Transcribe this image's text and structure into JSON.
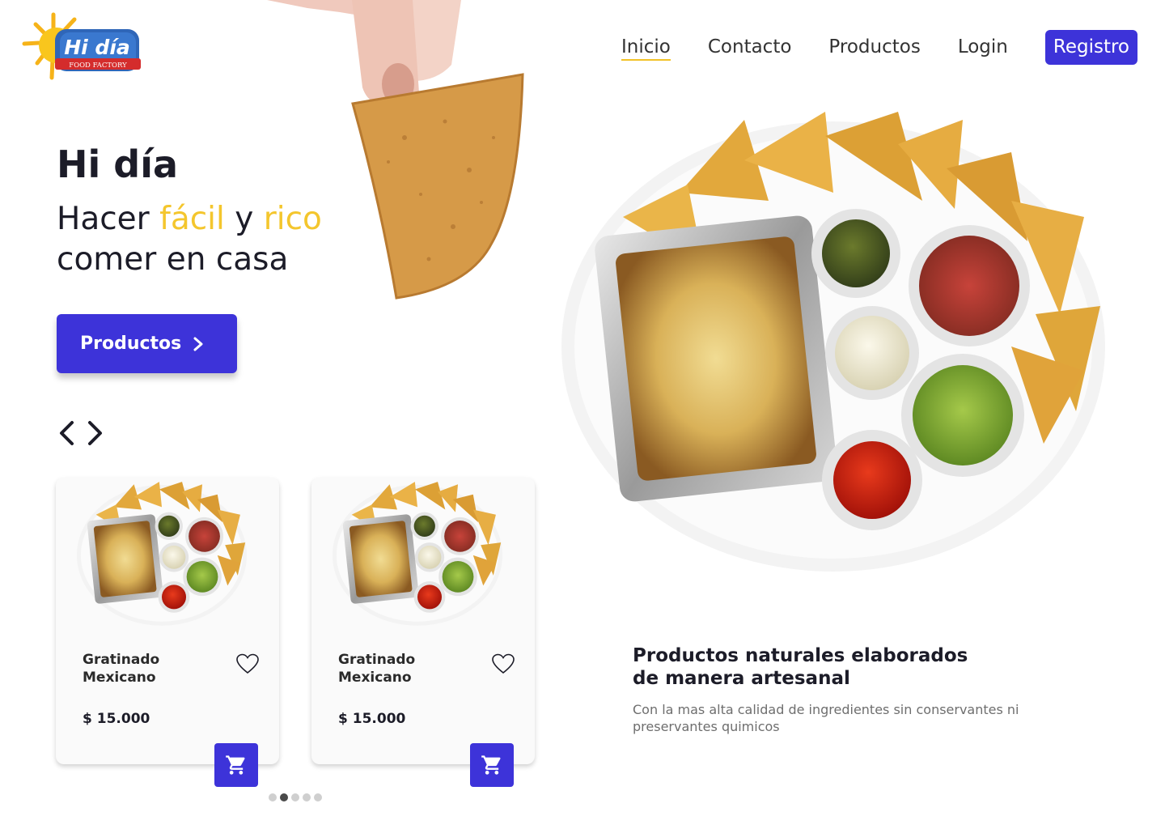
{
  "brand": {
    "logo_text": "Hi día",
    "logo_subtext": "FOOD FACTORY",
    "colors": {
      "primary": "#3d33d9",
      "accent": "#f4c62d",
      "text": "#1c1c28"
    }
  },
  "nav": {
    "items": [
      {
        "label": "Inicio",
        "active": true
      },
      {
        "label": "Contacto",
        "active": false
      },
      {
        "label": "Productos",
        "active": false
      },
      {
        "label": "Login",
        "active": false
      }
    ],
    "register_label": "Registro"
  },
  "hero": {
    "title": "Hi día",
    "subtitle_part1": "Hacer ",
    "subtitle_hl1": "fácil",
    "subtitle_part2": " y ",
    "subtitle_hl2": "rico",
    "subtitle_line2": "comer en casa",
    "cta_label": "Productos",
    "cta_icon": "chevron-right-icon"
  },
  "carousel": {
    "prev_icon": "chevron-left-icon",
    "next_icon": "chevron-right-icon",
    "products": [
      {
        "name": "Gratinado Mexicano",
        "price": "$ 15.000",
        "favorite_icon": "heart-icon",
        "cart_icon": "cart-icon"
      },
      {
        "name": "Gratinado Mexicano",
        "price": "$ 15.000",
        "favorite_icon": "heart-icon",
        "cart_icon": "cart-icon"
      }
    ],
    "pagination": {
      "total": 5,
      "active_index": 1
    }
  },
  "info": {
    "title": "Productos naturales elaborados de manera artesanal",
    "description": "Con la mas alta calidad de ingredientes sin conservantes ni preservantes quimicos"
  }
}
